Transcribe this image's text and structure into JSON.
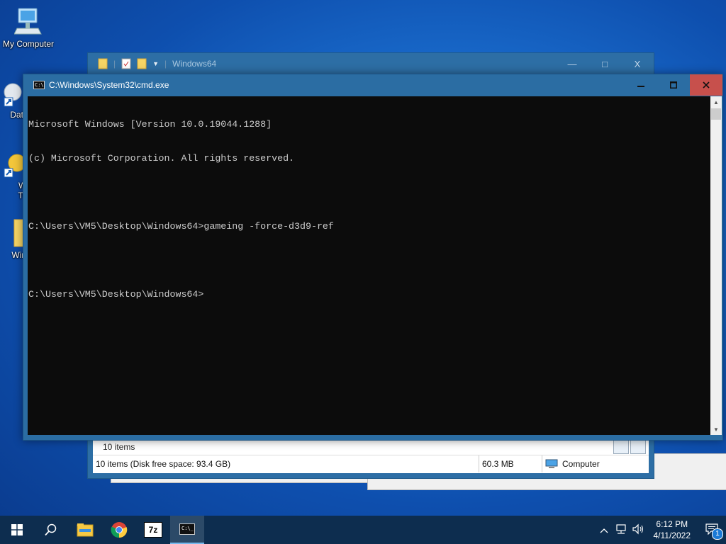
{
  "desktop": {
    "icons": [
      {
        "label": "My Computer",
        "icon": "computer-icon"
      },
      {
        "label": "DataV",
        "icon": "data-shortcut-icon"
      },
      {
        "label": "Wi Tw",
        "icon": "shortcut-icon"
      },
      {
        "label": "Wind",
        "icon": "folder-icon"
      }
    ]
  },
  "explorer": {
    "title": "Windows64",
    "items_count": "10 items",
    "status": {
      "items_free": "10 items (Disk free space: 93.4 GB)",
      "size": "60.3 MB",
      "location": "Computer"
    },
    "buttons": {
      "minimize": "—",
      "maximize": "□",
      "close": "X"
    }
  },
  "cmd": {
    "title": "C:\\Windows\\System32\\cmd.exe",
    "lines": [
      "Microsoft Windows [Version 10.0.19044.1288]",
      "(c) Microsoft Corporation. All rights reserved.",
      "",
      "C:\\Users\\VM5\\Desktop\\Windows64>gameing -force-d3d9-ref",
      "",
      "C:\\Users\\VM5\\Desktop\\Windows64>"
    ]
  },
  "taskbar": {
    "pinned": [
      "start-icon",
      "search-icon",
      "file-explorer-icon",
      "chrome-icon",
      "7zip-icon",
      "cmd-icon"
    ],
    "sevenzip_label": "7z",
    "clock": {
      "time": "6:12 PM",
      "date": "4/11/2022"
    },
    "notification_count": "1"
  },
  "colors": {
    "console_bg": "#0c0c0c",
    "console_text": "#cccccc",
    "window_frame": "#2b6da3",
    "close_button": "#c7504c",
    "taskbar": "#0d2d4f"
  }
}
